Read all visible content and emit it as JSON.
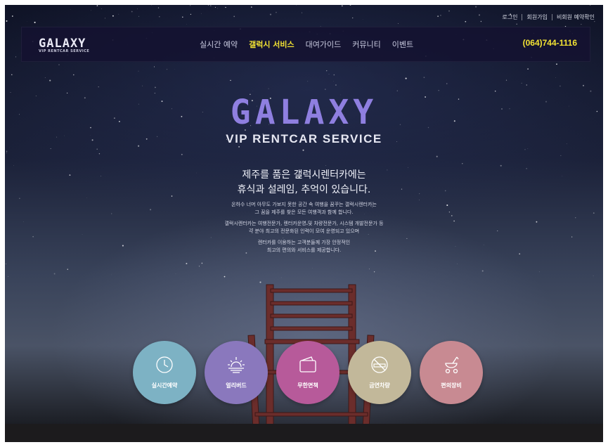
{
  "utility": {
    "login": "로그인",
    "join": "회원가입",
    "guest_check": "비회원 예약확인"
  },
  "header": {
    "logo": "GALAXY",
    "logo_sub": "VIP RENTCAR SERVICE",
    "menu": [
      "실시간 예약",
      "갤럭시 서비스",
      "대여가이드",
      "커뮤니티",
      "이벤트"
    ],
    "active_menu_index": 1,
    "phone": "(064)744-1116"
  },
  "hero": {
    "title": "GALAXY",
    "subtitle": "VIP RENTCAR SERVICE",
    "tagline_1": "제주를 품은 갤럭시렌터카에는",
    "tagline_2": "휴식과 설레임, 추억이 있습니다.",
    "paragraphs": [
      "온하수 너머 아무도 가보지 못한 공간 속 여행을 꿈꾸는 갤럭시렌터카는",
      "그 꿈을 제주를 찾은 모든 여행객과 함께 합니다.",
      "갤럭시렌터카는 여행전문가, 렌터카운영 및 차량전문가, 시스템 개발전문가 등",
      "각 분야 최고의 전문화된 인력이 모여 운영되고 있으며",
      "렌터카를 이용하는 고객분들께 가장 안정적인",
      "최고의 편의와 서비스를 제공합니다."
    ]
  },
  "services": [
    {
      "label": "실시간예약",
      "icon": "clock-icon",
      "color": "#7db2c4"
    },
    {
      "label": "얼리버드",
      "icon": "sunrise-icon",
      "color": "#8a78bd"
    },
    {
      "label": "무한면책",
      "icon": "wallet-icon",
      "color": "#b75a9a"
    },
    {
      "label": "금연차량",
      "icon": "no-smoking-icon",
      "color": "#c2b89a"
    },
    {
      "label": "편의장비",
      "icon": "stroller-icon",
      "color": "#c88a92"
    }
  ]
}
